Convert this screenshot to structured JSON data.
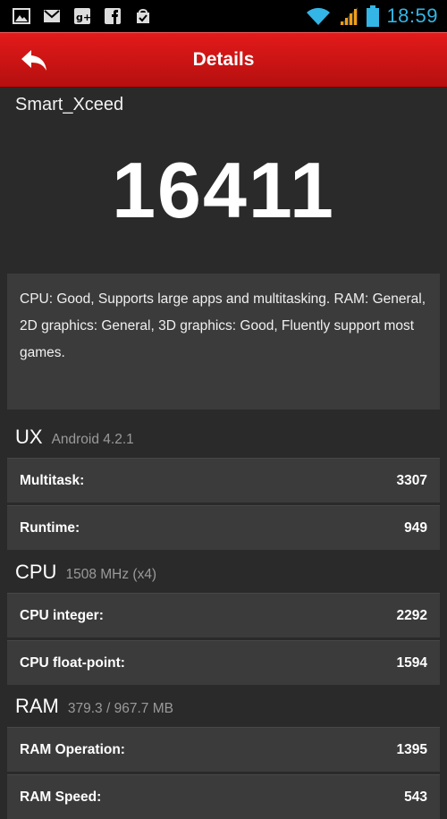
{
  "status_bar": {
    "time": "18:59",
    "notification_icons": [
      "gallery-icon",
      "gmail-icon",
      "google-plus-icon",
      "facebook-icon",
      "play-store-icon"
    ],
    "system_icons": [
      "wifi-icon",
      "signal-icon",
      "battery-icon"
    ]
  },
  "header": {
    "title": "Details",
    "back_icon": "back-arrow-icon"
  },
  "device_name": "Smart_Xceed",
  "score": "16411",
  "summary": "CPU: Good, Supports large apps and multitasking. RAM: General, 2D graphics: General, 3D graphics: Good, Fluently support most games.",
  "sections": [
    {
      "title": "UX",
      "subtitle": "Android 4.2.1",
      "rows": [
        {
          "label": "Multitask:",
          "value": "3307"
        },
        {
          "label": "Runtime:",
          "value": "949"
        }
      ]
    },
    {
      "title": "CPU",
      "subtitle": "1508 MHz (x4)",
      "rows": [
        {
          "label": "CPU integer:",
          "value": "2292"
        },
        {
          "label": "CPU float-point:",
          "value": "1594"
        }
      ]
    },
    {
      "title": "RAM",
      "subtitle": "379.3 / 967.7 MB",
      "rows": [
        {
          "label": "RAM Operation:",
          "value": "1395"
        },
        {
          "label": "RAM Speed:",
          "value": "543"
        }
      ]
    }
  ],
  "colors": {
    "header_red": "#d01414",
    "clock_blue": "#33b5e5",
    "background": "#2a2a2a",
    "card": "#3b3b3b"
  }
}
